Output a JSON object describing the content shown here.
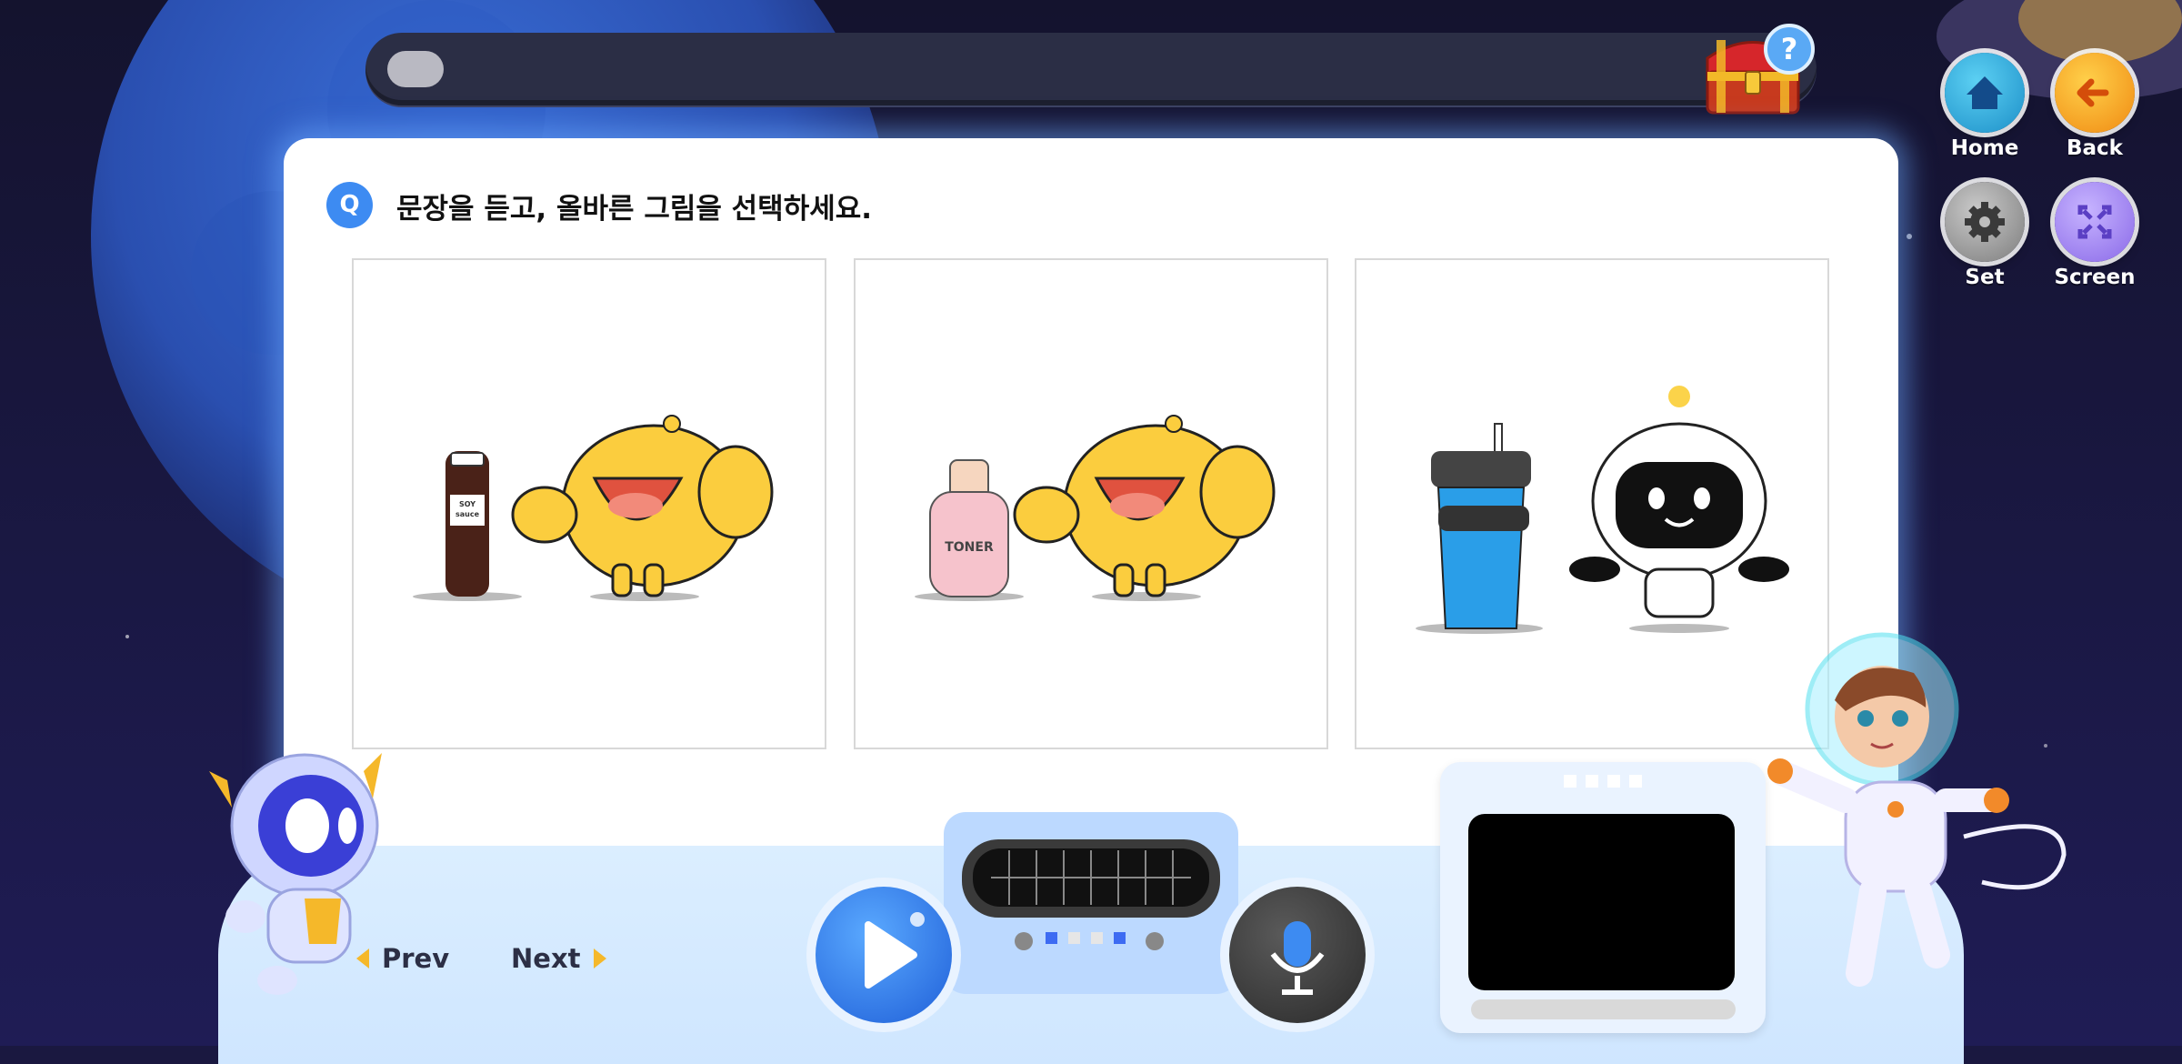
{
  "colors": {
    "background": "#1a1840",
    "accent_blue": "#3d8bf2",
    "home_button": "#29a6d9",
    "back_button": "#f5a623",
    "set_button": "#8c8c8c",
    "screen_button": "#9b7cf0",
    "play_button": "#2b7ff0",
    "mic_button": "#3a3a3a"
  },
  "progress": {
    "value_fraction": 0.04
  },
  "nav": {
    "home_label": "Home",
    "back_label": "Back",
    "set_label": "Set",
    "screen_label": "Screen"
  },
  "question": {
    "badge": "Q",
    "prompt": "문장을 듣고, 올바른 그림을 선택하세요."
  },
  "choices": [
    {
      "object": "soy sauce bottle",
      "object_text": "SOY\nsauce",
      "character": "yellow dog mascot"
    },
    {
      "object": "toner bottle",
      "object_text": "TONER",
      "character": "yellow dog mascot"
    },
    {
      "object": "blue tumbler",
      "object_text": "",
      "character": "astronaut robot mascot"
    }
  ],
  "footer": {
    "prev_label": "Prev",
    "next_label": "Next",
    "play_icon": "play-icon",
    "mic_icon": "microphone-icon",
    "page_dots_count": 4,
    "page_dots_active": [
      0,
      3
    ]
  }
}
